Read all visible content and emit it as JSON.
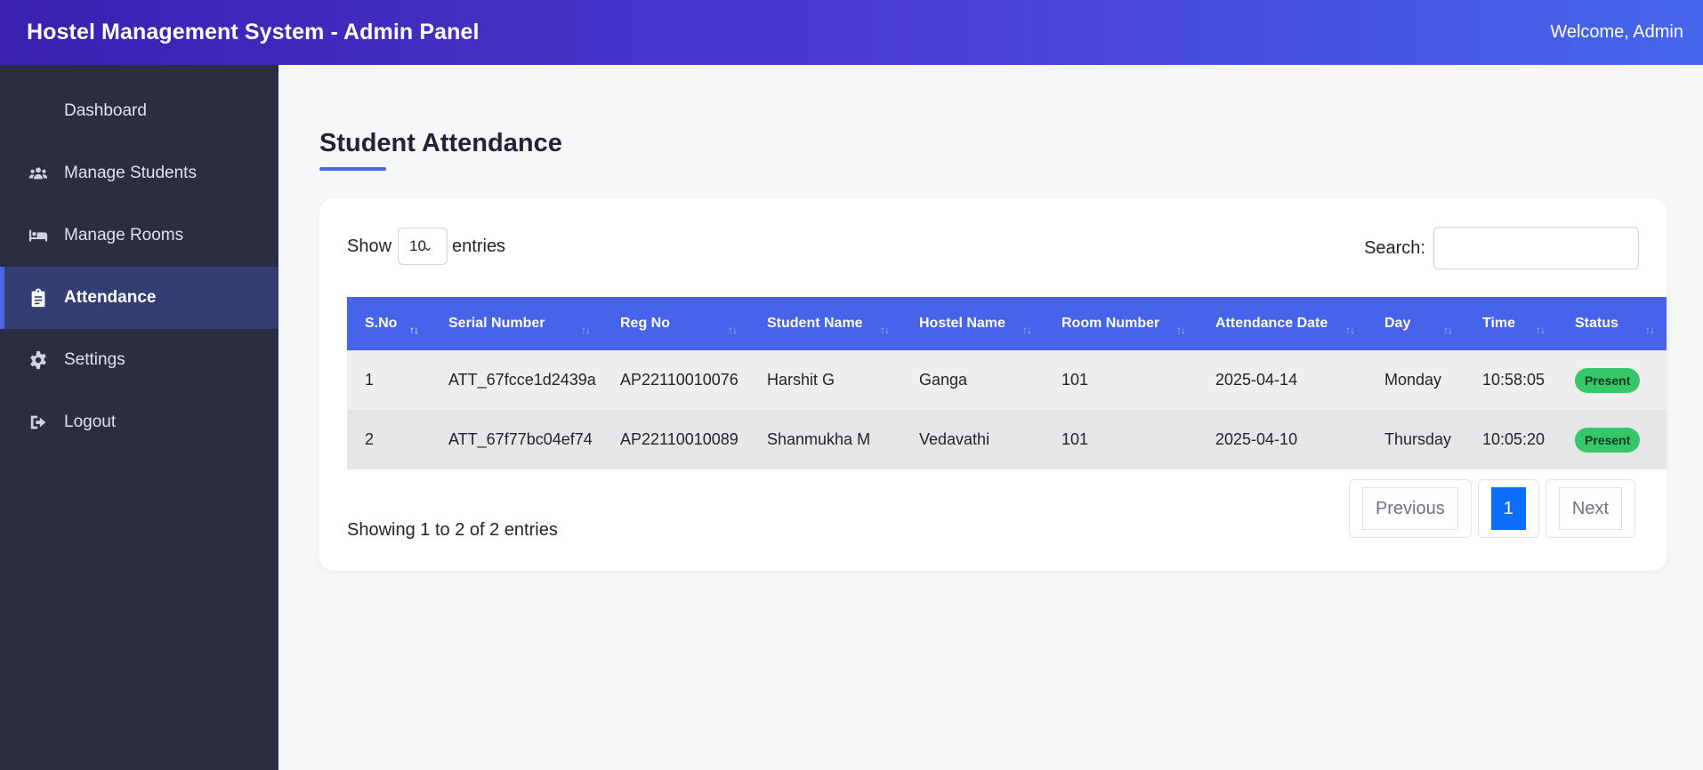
{
  "header": {
    "title": "Hostel Management System - Admin Panel",
    "welcome": "Welcome, Admin"
  },
  "sidebar": {
    "items": [
      {
        "label": "Dashboard",
        "icon": "none"
      },
      {
        "label": "Manage Students",
        "icon": "users-icon"
      },
      {
        "label": "Manage Rooms",
        "icon": "bed-icon"
      },
      {
        "label": "Attendance",
        "icon": "clipboard-icon",
        "active": true
      },
      {
        "label": "Settings",
        "icon": "gear-icon"
      },
      {
        "label": "Logout",
        "icon": "logout-icon"
      }
    ]
  },
  "page": {
    "title": "Student Attendance"
  },
  "controls": {
    "show_label": "Show",
    "length_value": "10",
    "entries_label": "entries",
    "search_label": "Search:",
    "search_value": ""
  },
  "table": {
    "columns": [
      "S.No",
      "Serial Number",
      "Reg No",
      "Student Name",
      "Hostel Name",
      "Room Number",
      "Attendance Date",
      "Day",
      "Time",
      "Status"
    ],
    "rows": [
      [
        "1",
        "ATT_67fcce1d2439a",
        "AP22110010076",
        "Harshit G",
        "Ganga",
        "101",
        "2025-04-14",
        "Monday",
        "10:58:05",
        "Present"
      ],
      [
        "2",
        "ATT_67f77bc04ef74",
        "AP22110010089",
        "Shanmukha M",
        "Vedavathi",
        "101",
        "2025-04-10",
        "Thursday",
        "10:05:20",
        "Present"
      ]
    ]
  },
  "footer": {
    "info": "Showing 1 to 2 of 2 entries",
    "previous": "Previous",
    "page": "1",
    "next": "Next"
  },
  "colors": {
    "accent": "#4763e9",
    "sidebar_bg": "#2b2d42",
    "badge_present": "#35c76a",
    "page_active": "#0d6efd"
  }
}
